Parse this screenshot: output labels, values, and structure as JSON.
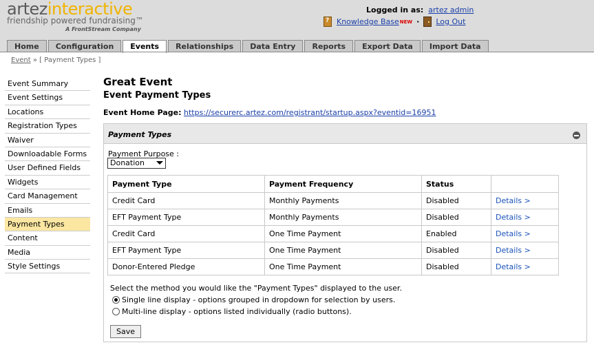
{
  "logo": {
    "part1": "artez",
    "part2": "interactive",
    "tagline": "friendship powered fundraising",
    "tm": "™",
    "company": "A FrontStream Company"
  },
  "user": {
    "logged_in_label": "Logged in as:",
    "username": "artez admin"
  },
  "links": {
    "knowledge_base": "Knowledge Base",
    "new_badge": "NEW",
    "separator": "·",
    "logout": "Log Out"
  },
  "tabs": [
    {
      "label": "Home"
    },
    {
      "label": "Configuration"
    },
    {
      "label": "Events"
    },
    {
      "label": "Relationships"
    },
    {
      "label": "Data Entry"
    },
    {
      "label": "Reports"
    },
    {
      "label": "Export Data"
    },
    {
      "label": "Import Data"
    }
  ],
  "breadcrumb": {
    "link": "Event",
    "sep": "»",
    "current": "[ Payment Types ]"
  },
  "sidebar": {
    "items": [
      {
        "label": "Event Summary"
      },
      {
        "label": "Event Settings"
      },
      {
        "label": "Locations"
      },
      {
        "label": "Registration Types"
      },
      {
        "label": "Waiver"
      },
      {
        "label": "Downloadable Forms"
      },
      {
        "label": "User Defined Fields"
      },
      {
        "label": "Widgets"
      },
      {
        "label": "Card Management"
      },
      {
        "label": "Emails"
      },
      {
        "label": "Payment Types"
      },
      {
        "label": "Content"
      },
      {
        "label": "Media"
      },
      {
        "label": "Style Settings"
      }
    ]
  },
  "main": {
    "event_title": "Great Event",
    "page_title": "Event Payment Types",
    "home_page_label": "Event Home Page:",
    "home_page_url": "https://securerc.artez.com/registrant/startup.aspx?eventid=16951"
  },
  "panel": {
    "title": "Payment Types",
    "purpose_label": "Payment Purpose :",
    "purpose_value": "Donation",
    "columns": [
      "Payment Type",
      "Payment Frequency",
      "Status",
      ""
    ],
    "rows": [
      {
        "type": "Credit Card",
        "frequency": "Monthly Payments",
        "status": "Disabled",
        "action": "Details >"
      },
      {
        "type": "EFT Payment Type",
        "frequency": "Monthly Payments",
        "status": "Disabled",
        "action": "Details >"
      },
      {
        "type": "Credit Card",
        "frequency": "One Time Payment",
        "status": "Enabled",
        "action": "Details >"
      },
      {
        "type": "EFT Payment Type",
        "frequency": "One Time Payment",
        "status": "Disabled",
        "action": "Details >"
      },
      {
        "type": "Donor-Entered Pledge",
        "frequency": "One Time Payment",
        "status": "Disabled",
        "action": "Details >"
      }
    ],
    "method_text": "Select the method you would like the \"Payment Types\" displayed to the user.",
    "option_single": "Single line display - options grouped in dropdown for selection by users.",
    "option_multi": "Multi-line display - options listed individually (radio buttons).",
    "save_label": "Save"
  }
}
